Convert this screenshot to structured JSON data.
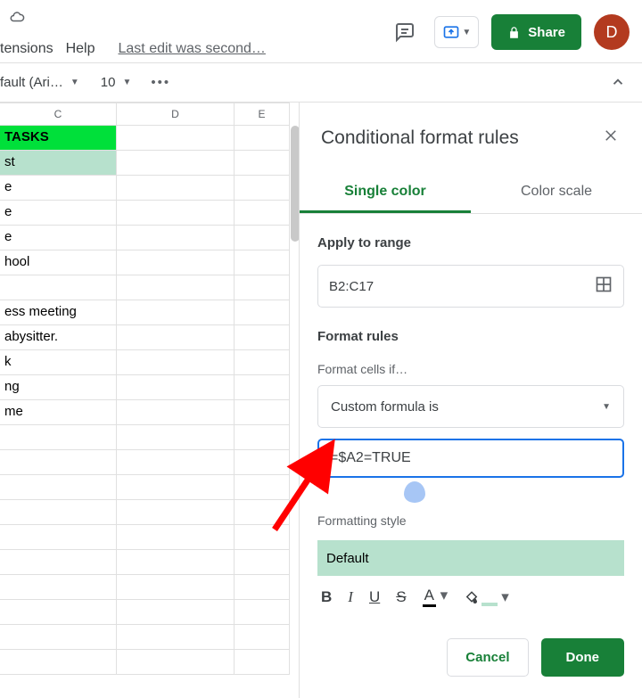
{
  "topbar": {
    "menus": [
      "tensions",
      "Help"
    ],
    "last_edit": "Last edit was second…",
    "share_label": "Share",
    "avatar_letter": "D"
  },
  "toolbar": {
    "font_name": "fault (Ari…",
    "font_size": "10"
  },
  "columns": {
    "c": "C",
    "d": "D",
    "e": "E"
  },
  "rows": [
    {
      "c": " TASKS",
      "cls": "hdr-tasks"
    },
    {
      "c": "st",
      "cls": "hl"
    },
    {
      "c": "e"
    },
    {
      "c": "e"
    },
    {
      "c": "e"
    },
    {
      "c": "hool"
    },
    {
      "c": ""
    },
    {
      "c": "ess meeting"
    },
    {
      "c": "abysitter."
    },
    {
      "c": "k"
    },
    {
      "c": "ng"
    },
    {
      "c": "me"
    },
    {
      "c": ""
    },
    {
      "c": ""
    },
    {
      "c": ""
    },
    {
      "c": ""
    },
    {
      "c": ""
    },
    {
      "c": ""
    },
    {
      "c": ""
    },
    {
      "c": ""
    },
    {
      "c": ""
    },
    {
      "c": ""
    }
  ],
  "panel": {
    "title": "Conditional format rules",
    "tabs": {
      "single": "Single color",
      "scale": "Color scale"
    },
    "apply_label": "Apply to range",
    "range_value": "B2:C17",
    "rules_label": "Format rules",
    "cells_if_label": "Format cells if…",
    "condition_value": "Custom formula is",
    "formula_value": "=$A2=TRUE",
    "style_label": "Formatting style",
    "style_name": "Default",
    "cancel": "Cancel",
    "done": "Done"
  }
}
